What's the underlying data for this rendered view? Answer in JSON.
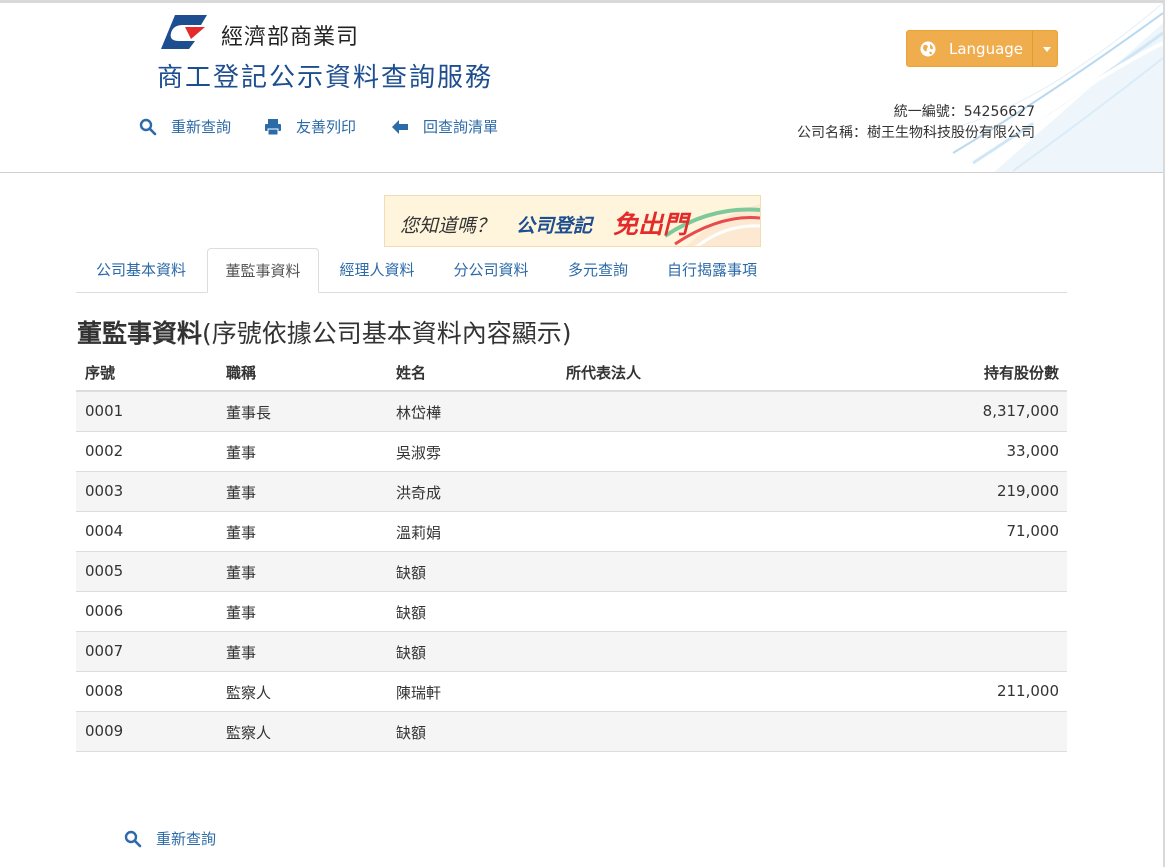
{
  "header": {
    "ministry": "經濟部商業司",
    "service_title": "商工登記公示資料查詢服務",
    "actions": [
      {
        "label": "重新查詢",
        "icon": "search-icon"
      },
      {
        "label": "友善列印",
        "icon": "printer-icon"
      },
      {
        "label": "回查詢清單",
        "icon": "arrow-left-icon"
      }
    ],
    "language_button": "Language",
    "unified_number": "統一編號：54256627",
    "company_name": "公司名稱：樹王生物科技股份有限公司"
  },
  "banner": {
    "question": "您知道嗎？",
    "registration": "公司登記",
    "no_go_out": "免出門"
  },
  "tabs": [
    {
      "label": "公司基本資料",
      "active": false
    },
    {
      "label": "董監事資料",
      "active": true
    },
    {
      "label": "經理人資料",
      "active": false
    },
    {
      "label": "分公司資料",
      "active": false
    },
    {
      "label": "多元查詢",
      "active": false
    },
    {
      "label": "自行揭露事項",
      "active": false
    }
  ],
  "section": {
    "title_strong": "董監事資料",
    "title_note": "(序號依據公司基本資料內容顯示)"
  },
  "table": {
    "headers": [
      "序號",
      "職稱",
      "姓名",
      "所代表法人",
      "持有股份數"
    ],
    "rows": [
      [
        "0001",
        "董事長",
        "林岱樺",
        "",
        "8,317,000"
      ],
      [
        "0002",
        "董事",
        "吳淑雰",
        "",
        "33,000"
      ],
      [
        "0003",
        "董事",
        "洪奇成",
        "",
        "219,000"
      ],
      [
        "0004",
        "董事",
        "溫莉娟",
        "",
        "71,000"
      ],
      [
        "0005",
        "董事",
        "缺額",
        "",
        ""
      ],
      [
        "0006",
        "董事",
        "缺額",
        "",
        ""
      ],
      [
        "0007",
        "董事",
        "缺額",
        "",
        ""
      ],
      [
        "0008",
        "監察人",
        "陳瑞軒",
        "",
        "211,000"
      ],
      [
        "0009",
        "監察人",
        "缺額",
        "",
        ""
      ]
    ]
  },
  "footer": {
    "requery_label": "重新查詢"
  },
  "colors": {
    "brand_blue": "#1d4e8f",
    "link_blue": "#2d6aa8",
    "language_orange": "#f0ad4e",
    "banner_red": "#e32b2b"
  }
}
